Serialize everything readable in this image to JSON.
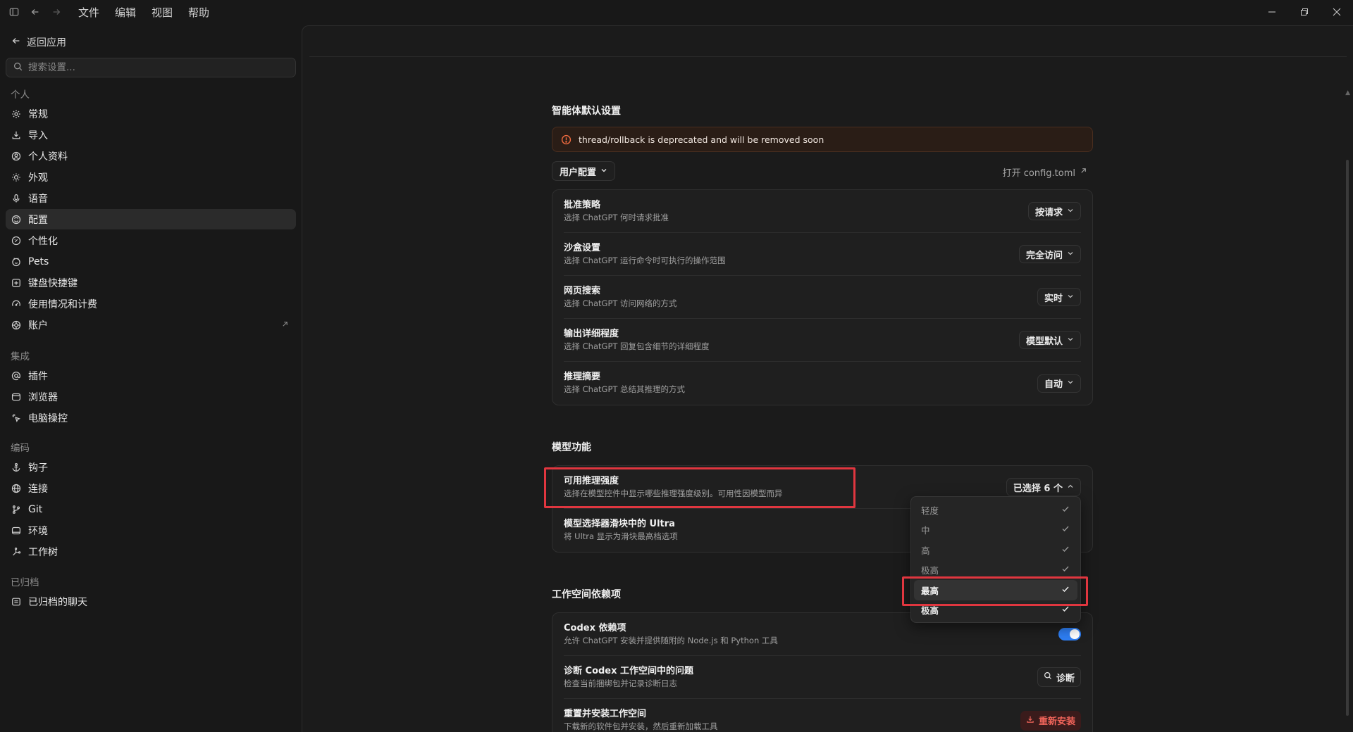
{
  "titlebar": {
    "menus": [
      "文件",
      "编辑",
      "视图",
      "帮助"
    ]
  },
  "sidebar": {
    "back_label": "返回应用",
    "search_placeholder": "搜索设置...",
    "sections": [
      {
        "title": "个人",
        "items": [
          {
            "label": "常规",
            "icon": "gear-icon"
          },
          {
            "label": "导入",
            "icon": "import-icon"
          },
          {
            "label": "个人资料",
            "icon": "profile-icon"
          },
          {
            "label": "外观",
            "icon": "sun-icon"
          },
          {
            "label": "语音",
            "icon": "mic-icon"
          },
          {
            "label": "配置",
            "icon": "config-icon",
            "active": true
          },
          {
            "label": "个性化",
            "icon": "personalize-icon"
          },
          {
            "label": "Pets",
            "icon": "pets-icon"
          },
          {
            "label": "键盘快捷键",
            "icon": "keyboard-icon"
          },
          {
            "label": "使用情况和计费",
            "icon": "gauge-icon"
          },
          {
            "label": "账户",
            "icon": "account-icon",
            "external": true
          }
        ]
      },
      {
        "title": "集成",
        "items": [
          {
            "label": "插件",
            "icon": "at-icon"
          },
          {
            "label": "浏览器",
            "icon": "browser-icon"
          },
          {
            "label": "电脑操控",
            "icon": "cursor-icon"
          }
        ]
      },
      {
        "title": "编码",
        "items": [
          {
            "label": "钩子",
            "icon": "anchor-icon"
          },
          {
            "label": "连接",
            "icon": "globe-icon"
          },
          {
            "label": "Git",
            "icon": "git-branch-icon"
          },
          {
            "label": "环境",
            "icon": "terminal-icon"
          },
          {
            "label": "工作树",
            "icon": "worktree-icon"
          }
        ]
      },
      {
        "title": "已归档",
        "items": [
          {
            "label": "已归档的聊天",
            "icon": "archive-icon"
          }
        ]
      }
    ]
  },
  "main": {
    "agent_defaults_title": "智能体默认设置",
    "banner_text": "thread/rollback is deprecated and will be removed soon",
    "profile_dropdown": "用户配置",
    "open_config": "打开 config.toml",
    "settings": [
      {
        "title": "批准策略",
        "desc": "选择 ChatGPT 何时请求批准",
        "value": "按请求"
      },
      {
        "title": "沙盒设置",
        "desc": "选择 ChatGPT 运行命令时可执行的操作范围",
        "value": "完全访问"
      },
      {
        "title": "网页搜索",
        "desc": "选择 ChatGPT 访问网络的方式",
        "value": "实时"
      },
      {
        "title": "输出详细程度",
        "desc": "选择 ChatGPT 回复包含细节的详细程度",
        "value": "模型默认"
      },
      {
        "title": "推理摘要",
        "desc": "选择 ChatGPT 总结其推理的方式",
        "value": "自动"
      }
    ],
    "model_features_title": "模型功能",
    "model_features": [
      {
        "title": "可用推理强度",
        "desc": "选择在模型控件中显示哪些推理强度级别。可用性因模型而异",
        "value": "已选择 6 个"
      },
      {
        "title": "模型选择器滑块中的 Ultra",
        "desc": "将 Ultra 显示为滑块最高档选项"
      }
    ],
    "workspace_title": "工作空间依赖项",
    "workspace": [
      {
        "title": "Codex 依赖项",
        "desc": "允许 ChatGPT 安装并提供随附的 Node.js 和 Python 工具",
        "toggle": true
      },
      {
        "title": "诊断 Codex 工作空间中的问题",
        "desc": "检查当前捆绑包并记录诊断日志",
        "button": "诊断"
      },
      {
        "title": "重置并安装工作空间",
        "desc": "下载新的软件包并安装，然后重新加载工具",
        "button": "重新安装"
      }
    ]
  },
  "popover": {
    "options": [
      {
        "label": "轻度",
        "checked": true
      },
      {
        "label": "中",
        "checked": true
      },
      {
        "label": "高",
        "checked": true
      },
      {
        "label": "极高",
        "checked": true
      },
      {
        "label": "最高",
        "checked": true,
        "highlighted": true
      },
      {
        "label": "极高",
        "checked": true
      }
    ]
  },
  "colors": {
    "accent_toggle": "#2e7ff5",
    "highlight_box": "#e0363f",
    "danger_text": "#f0645a",
    "warning_icon": "#f06b3f"
  }
}
